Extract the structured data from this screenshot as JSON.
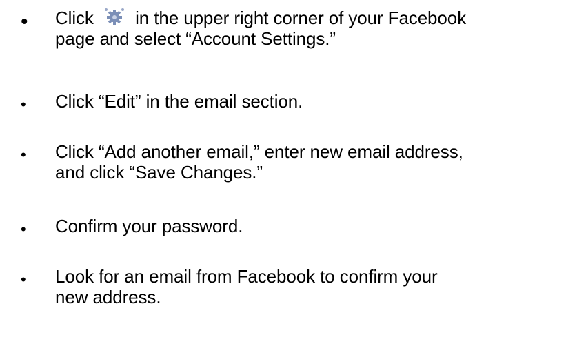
{
  "bullets": [
    {
      "lines": [
        {
          "before_icon": "Click",
          "icon": "gear-icon",
          "after_icon": "in the upper right corner of your Facebook"
        },
        {
          "text": "page and select “Account Settings.”"
        }
      ]
    },
    {
      "lines": [
        {
          "text": "Click “Edit” in the email section."
        }
      ]
    },
    {
      "lines": [
        {
          "text": "Click “Add another email,” enter new email address,"
        },
        {
          "text": "and click “Save Changes.”"
        }
      ]
    },
    {
      "lines": [
        {
          "text": "Confirm your password."
        }
      ]
    },
    {
      "lines": [
        {
          "text": "Look for an email from Facebook to confirm your"
        },
        {
          "text": "new address."
        }
      ]
    }
  ],
  "bullet_glyph": "•",
  "colors": {
    "text": "#000000",
    "gear_fill": "#7b8fb7",
    "gear_dots": "#9aa8c8"
  }
}
